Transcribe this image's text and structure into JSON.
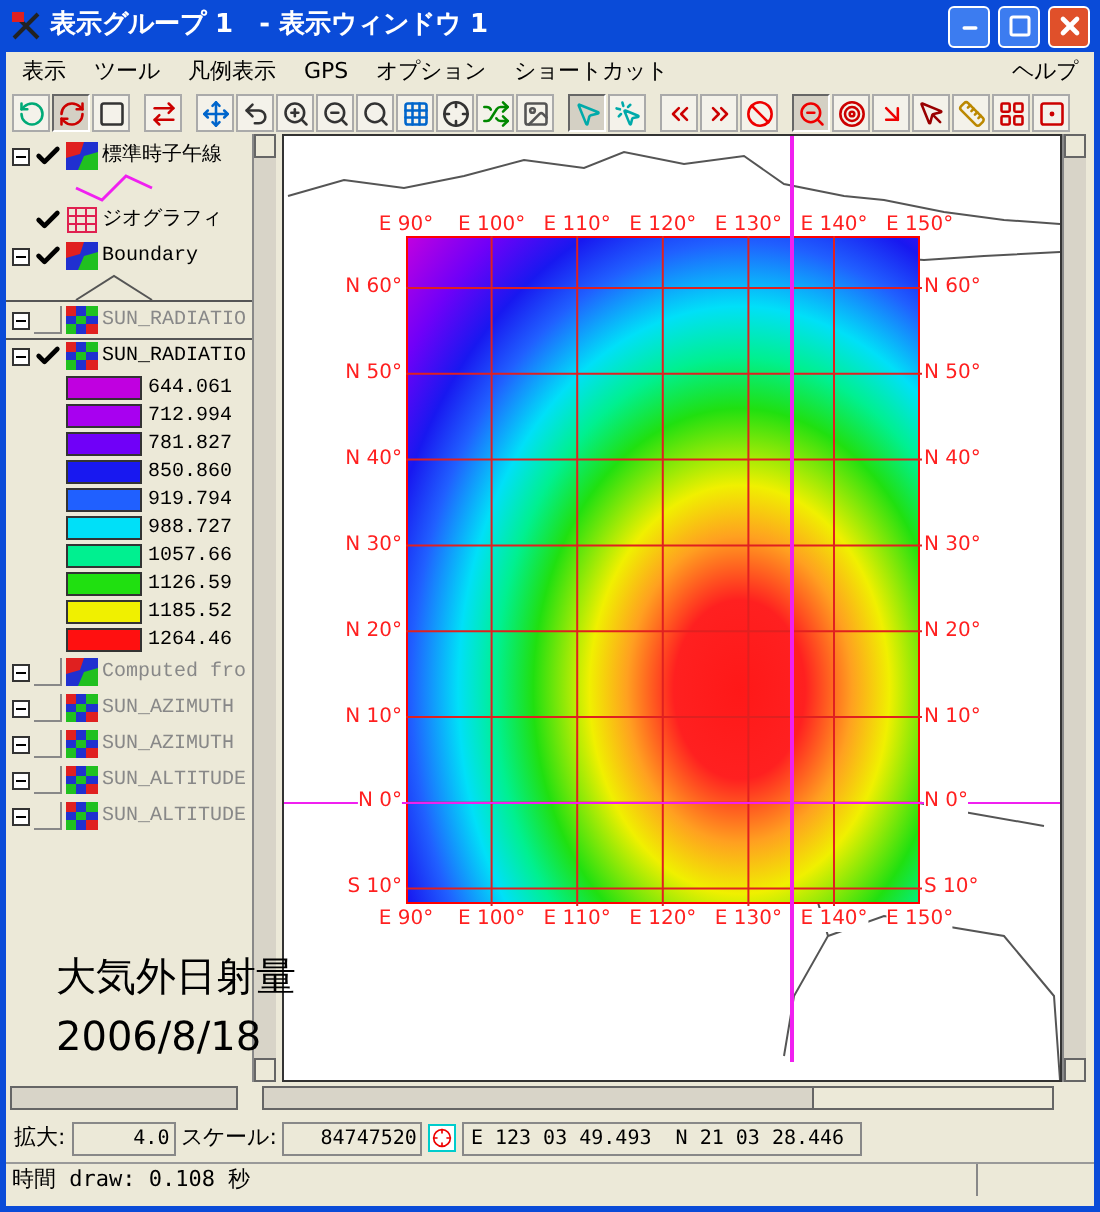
{
  "window": {
    "title": "表示グループ 1　- 表示ウィンドウ 1"
  },
  "menu": [
    "表示",
    "ツール",
    "凡例表示",
    "GPS",
    "オプション",
    "ショートカット"
  ],
  "help_menu": "ヘルプ",
  "toolbar": [
    {
      "pressed": false
    },
    {
      "pressed": true
    },
    {
      "pressed": false
    },
    {
      "pressed": false
    },
    {
      "pressed": false
    },
    {
      "pressed": false
    },
    {
      "pressed": false
    },
    {
      "pressed": false
    },
    {
      "pressed": false
    },
    {
      "pressed": false
    },
    {
      "pressed": false
    },
    {
      "pressed": false
    },
    {
      "pressed": false
    },
    {
      "pressed": true
    },
    {
      "pressed": false
    },
    {
      "pressed": false
    },
    {
      "pressed": false
    },
    {
      "pressed": false
    },
    {
      "pressed": true
    },
    {
      "pressed": false
    },
    {
      "pressed": false
    },
    {
      "pressed": false
    },
    {
      "pressed": false
    },
    {
      "pressed": false
    },
    {
      "pressed": false
    }
  ],
  "layers": [
    {
      "name": "標準時子午線",
      "kind": "vector",
      "expandable": true,
      "checked": true,
      "selected": false,
      "symbol": {
        "kind": "zigzag"
      }
    },
    {
      "name": "ジオグラフィ",
      "kind": "grid",
      "expandable": false,
      "checked": true,
      "selected": false
    },
    {
      "name": "Boundary",
      "kind": "vector",
      "expandable": true,
      "checked": true,
      "selected": false,
      "symbol": {
        "kind": "lines"
      }
    },
    {
      "name": "SUN_RADIATIO",
      "kind": "raster",
      "expandable": true,
      "checked": false,
      "selected": true
    },
    {
      "name": "SUN_RADIATIO",
      "kind": "raster",
      "expandable": true,
      "checked": true,
      "selected": false,
      "legend": [
        {
          "label": "644.061",
          "color": "#c000e0"
        },
        {
          "label": "712.994",
          "color": "#a800f0"
        },
        {
          "label": "781.827",
          "color": "#7000f8"
        },
        {
          "label": "850.860",
          "color": "#1818f0"
        },
        {
          "label": "919.794",
          "color": "#2060ff"
        },
        {
          "label": "988.727",
          "color": "#00e0f8"
        },
        {
          "label": "1057.66",
          "color": "#00f090"
        },
        {
          "label": "1126.59",
          "color": "#20e010"
        },
        {
          "label": "1185.52",
          "color": "#f0f000"
        },
        {
          "label": "1264.46",
          "color": "#ff1010"
        }
      ]
    },
    {
      "name": "Computed fro",
      "kind": "vector",
      "expandable": true,
      "checked": false,
      "selected": false
    },
    {
      "name": "SUN_AZIMUTH",
      "kind": "raster",
      "expandable": true,
      "checked": false,
      "selected": false
    },
    {
      "name": "SUN_AZIMUTH",
      "kind": "raster",
      "expandable": true,
      "checked": false,
      "selected": false
    },
    {
      "name": "SUN_ALTITUDE",
      "kind": "raster",
      "expandable": true,
      "checked": false,
      "selected": false
    },
    {
      "name": "SUN_ALTITUDE",
      "kind": "raster",
      "expandable": true,
      "checked": false,
      "selected": false
    }
  ],
  "map": {
    "top_labels": [
      "E 90°",
      "E 100°",
      "E 110°",
      "E 120°",
      "E 130°",
      "E 140°",
      "E 150°"
    ],
    "bottom_labels": [
      "E 90°",
      "E 100°",
      "E 110°",
      "E 120°",
      "E 130°",
      "E 140°",
      "E 150°"
    ],
    "left_labels": [
      "N 60°",
      "N 50°",
      "N 40°",
      "N 30°",
      "N 20°",
      "N 10°",
      "N 0°",
      "S 10°"
    ],
    "right_labels": [
      "N 60°",
      "N 50°",
      "N 40°",
      "N 30°",
      "N 20°",
      "N 10°",
      "N 0°",
      "S 10°"
    ]
  },
  "caption": {
    "title": "大気外日射量",
    "date": "2006/8/18"
  },
  "status": {
    "zoom_label": "拡大:",
    "zoom": "4.0",
    "scale_label": "スケール:",
    "scale": "84747520",
    "coords": "E 123 03 49.493  N 21 03 28.446"
  },
  "footer": "時間 draw: 0.108 秒"
}
